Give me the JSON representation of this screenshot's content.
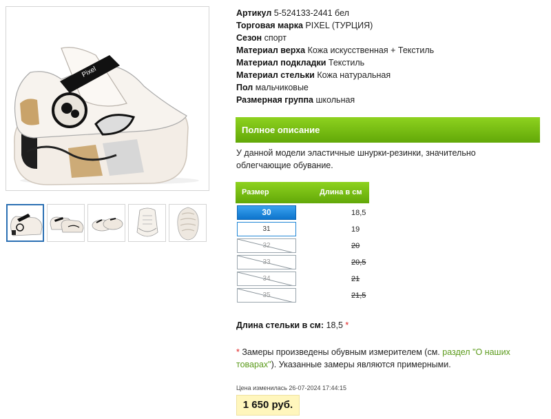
{
  "colors": {
    "accent_green": "#72b913",
    "selected_blue": "#1f86d6",
    "price_bg": "#fff6bd",
    "required_red": "#e02020",
    "link_green": "#5a9a1a"
  },
  "gallery": {
    "main_image": "sneaker-side-view",
    "thumbnails": [
      "sneaker-side-view",
      "sneaker-pair-side",
      "sneaker-pair-front",
      "sneaker-front",
      "sneaker-sole"
    ]
  },
  "specs": [
    {
      "label": "Артикул",
      "value": "5-524133-2441 бел"
    },
    {
      "label": "Торговая марка",
      "value": "PIXEL (ТУРЦИЯ)"
    },
    {
      "label": "Сезон",
      "value": "спорт"
    },
    {
      "label": "Материал верха",
      "value": "Кожа искусственная + Текстиль"
    },
    {
      "label": "Материал подкладки",
      "value": "Текстиль"
    },
    {
      "label": "Материал стельки",
      "value": "Кожа натуральная"
    },
    {
      "label": "Пол",
      "value": "мальчиковые"
    },
    {
      "label": "Размерная группа",
      "value": "школьная"
    }
  ],
  "description": {
    "header": "Полное описание",
    "text": "У данной модели эластичные шнурки-резинки, значительно облегчающие обувание."
  },
  "size_table": {
    "col_size": "Размер",
    "col_length": "Длина в см",
    "rows": [
      {
        "size": "30",
        "length": "18,5",
        "state": "selected"
      },
      {
        "size": "31",
        "length": "19",
        "state": "available"
      },
      {
        "size": "32",
        "length": "20",
        "state": "disabled"
      },
      {
        "size": "33",
        "length": "20,5",
        "state": "disabled"
      },
      {
        "size": "34",
        "length": "21",
        "state": "disabled"
      },
      {
        "size": "35",
        "length": "21,5",
        "state": "disabled"
      }
    ]
  },
  "insole": {
    "label": "Длина стельки в см:",
    "value": "18,5",
    "star": "*"
  },
  "note": {
    "star": "*",
    "before": " Замеры произведены обувным измерителем (см. ",
    "link": "раздел \"О наших товарах\"",
    "after": "). Указанные замеры являются примерными."
  },
  "price": {
    "changed": "Цена изменилась 26-07-2024 17:44:15",
    "value": "1 650 руб."
  }
}
